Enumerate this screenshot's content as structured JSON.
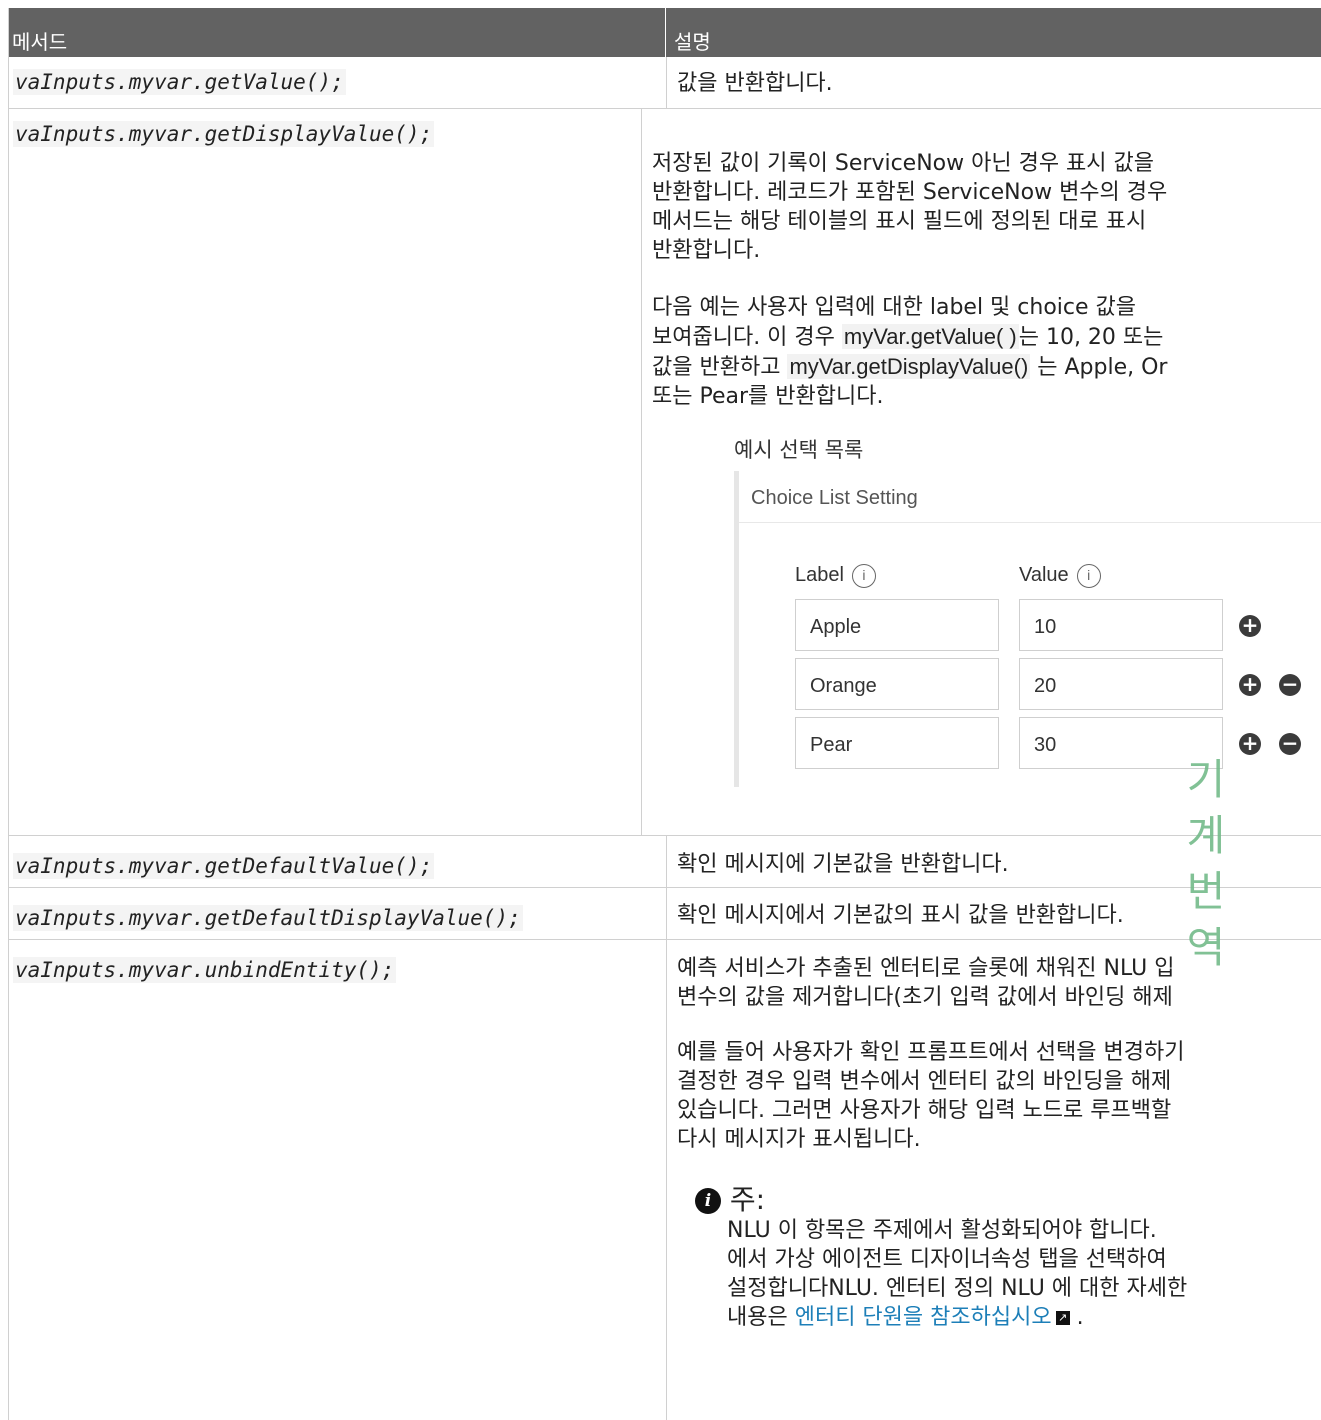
{
  "table": {
    "headers": {
      "method": "메서드",
      "description": "설명"
    },
    "rows": [
      {
        "method": "vaInputs.myvar.getValue();",
        "desc": "값을 반환합니다."
      },
      {
        "method": "vaInputs.myvar.getDisplayValue();",
        "para1": [
          "저장된 값이 기록이 ServiceNow 아닌 경우 표시 값을",
          "반환합니다. 레코드가 포함된 ServiceNow 변수의 경우",
          "메서드는 해당 테이블의 표시 필드에 정의된 대로 표시",
          "반환합니다."
        ],
        "para2_line1": "다음 예는 사용자 입력에 대한 label 및 choice 값을",
        "para2_line2_pre": "보여줍니다. 이 경우 ",
        "para2_line2_code": "myVar.getValue( )",
        "para2_line2_post": "는 10, 20 또는",
        "para2_line3_pre": "값을 반환하고 ",
        "para2_line3_code": "myVar.getDisplayValue()",
        "para2_line3_post": " 는 Apple, Or",
        "para2_line4": "또는 Pear를 반환합니다.",
        "figure_caption": "예시 선택 목록",
        "choice_list": {
          "title": "Choice List Setting",
          "label_header": "Label",
          "value_header": "Value",
          "info_glyph": "i",
          "items": [
            {
              "label": "Apple",
              "value": "10"
            },
            {
              "label": "Orange",
              "value": "20"
            },
            {
              "label": "Pear",
              "value": "30"
            }
          ]
        }
      },
      {
        "method": "vaInputs.myvar.getDefaultValue();",
        "desc": "확인 메시지에 기본값을 반환합니다."
      },
      {
        "method": "vaInputs.myvar.getDefaultDisplayValue();",
        "desc": "확인 메시지에서 기본값의 표시 값을 반환합니다."
      },
      {
        "method": "vaInputs.myvar.unbindEntity();",
        "para1": [
          "예측 서비스가 추출된 엔터티로 슬롯에 채워진 NLU 입",
          "변수의 값을 제거합니다(초기 입력 값에서 바인딩 해제"
        ],
        "para2": [
          "예를 들어 사용자가 확인 프롬프트에서 선택을 변경하기",
          "결정한 경우 입력 변수에서 엔터티 값의 바인딩을 해제",
          "있습니다. 그러면 사용자가 해당 입력 노드로 루프백할",
          "다시 메시지가 표시됩니다."
        ],
        "note": {
          "title": "주:",
          "icon_glyph": "i",
          "lines": [
            "NLU 이 항목은 주제에서 활성화되어야 합니다.",
            "에서 가상 에이전트 디자이너속성 탭을 선택하여",
            "설정합니다NLU. 엔터티 정의 NLU 에 대한 자세한"
          ],
          "last_pre": "내용은 ",
          "link": "엔터티 단원을 참조하십시오",
          "last_post": "."
        }
      }
    ]
  },
  "watermark": [
    "기",
    "계",
    "번",
    "역"
  ],
  "colors": {
    "header_bg": "#626262",
    "link": "#1d7fb8",
    "watermark": "#74bb8a"
  },
  "icons": {
    "plus": "+",
    "minus": "−",
    "external": "↗"
  }
}
